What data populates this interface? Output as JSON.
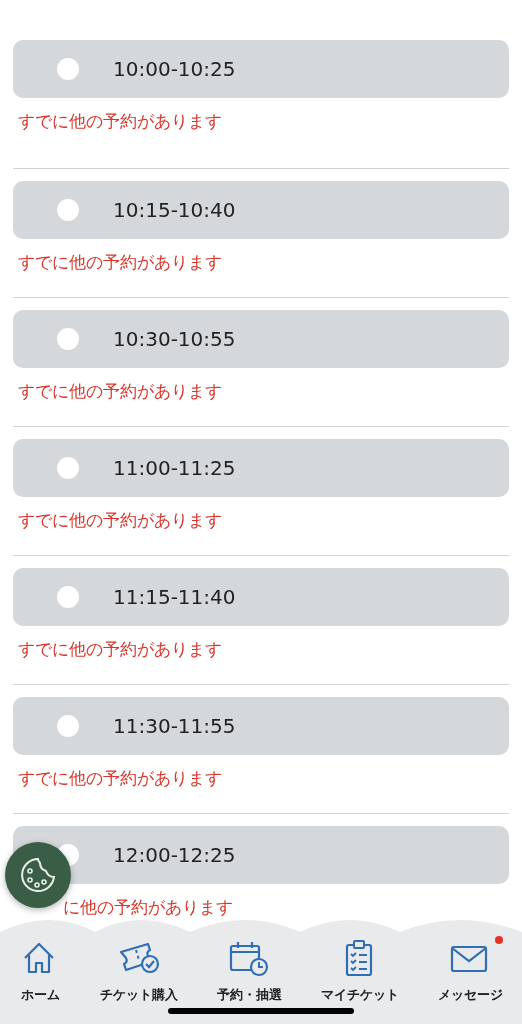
{
  "slots": [
    {
      "time": "10:00-10:25",
      "selected": false,
      "message": "すでに他の予約があります"
    },
    {
      "time": "10:15-10:40",
      "selected": false,
      "message": "すでに他の予約があります"
    },
    {
      "time": "10:30-10:55",
      "selected": false,
      "message": "すでに他の予約があります"
    },
    {
      "time": "11:00-11:25",
      "selected": false,
      "message": "すでに他の予約があります"
    },
    {
      "time": "11:15-11:40",
      "selected": false,
      "message": "すでに他の予約があります"
    },
    {
      "time": "11:30-11:55",
      "selected": false,
      "message": "すでに他の予約があります"
    },
    {
      "time": "12:00-12:25",
      "selected": false,
      "message": "に他の予約があります"
    }
  ],
  "nav": [
    {
      "kind": "home",
      "label": "ホーム",
      "badge": false
    },
    {
      "kind": "ticket",
      "label": "チケット購入",
      "badge": false
    },
    {
      "kind": "calendar",
      "label": "予約・抽選",
      "badge": false
    },
    {
      "kind": "clipboard",
      "label": "マイチケット",
      "badge": false
    },
    {
      "kind": "mail",
      "label": "メッセージ",
      "badge": true
    }
  ]
}
